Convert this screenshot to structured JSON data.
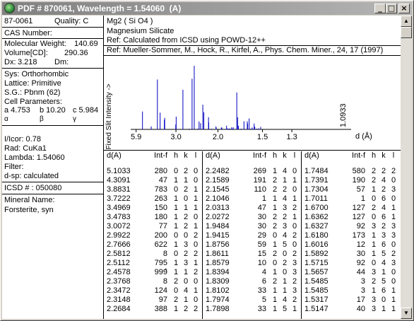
{
  "window": {
    "title": "PDF # 870061, Wavelength = 1.54060  (A)",
    "buttons": {
      "minimize": "_",
      "maximize": "□",
      "close": "×"
    }
  },
  "left": {
    "pdf_number": "87-0061",
    "quality": "Quality: C",
    "cas_label": "CAS Number:",
    "mol_weight_label": "Molecular Weight:",
    "mol_weight_value": "140.69",
    "volume_label": "Volume[CD]:",
    "volume_value": "290.36",
    "dx_label": "Dx:",
    "dx_value": "3.218",
    "dm_label": "Dm:",
    "sys": "Sys: Orthorhombic",
    "lattice": "Lattice: Primitive",
    "sg": "S.G.: Pbnm (62)",
    "cell_label": "Cell Parameters:",
    "cell_a": "a  4.753",
    "cell_b": "b  10.20",
    "cell_c": "c  5.984",
    "alpha": "α",
    "beta": "β",
    "gamma": "γ",
    "icor": "I/Icor:   0.78",
    "rad": "Rad: CuKa1",
    "lambda": "Lambda: 1.54060",
    "filter": "Filter:",
    "dsp": "d-sp: calculated",
    "icsd": "ICSD # : 050080",
    "mineral_label": "Mineral Name:",
    "mineral_value": "Forsterite, syn"
  },
  "right": {
    "formula": "Mg2 ( Si O4 )",
    "name": "Magnesium Silicate",
    "ref1": "Ref:  Calculated from ICSD using POWD-12++",
    "ref2": "Ref:  Mueller-Sommer, M., Hock, R., Kirfel, A., Phys. Chem. Miner., 24, 17 (1997)"
  },
  "chart_data": {
    "type": "bar",
    "ylabel": "Fixed Slit Intensity ->",
    "xlabel": "d (Å)",
    "xticks": [
      "5.9",
      "3.0",
      "2.0",
      "1.5",
      "1.3"
    ],
    "annotation": "1.0933",
    "peaks": [
      {
        "d": 5.1033,
        "i": 280
      },
      {
        "d": 4.3091,
        "i": 47
      },
      {
        "d": 3.8831,
        "i": 783
      },
      {
        "d": 3.7222,
        "i": 263
      },
      {
        "d": 3.4969,
        "i": 150
      },
      {
        "d": 3.4783,
        "i": 180
      },
      {
        "d": 3.0072,
        "i": 77
      },
      {
        "d": 2.9922,
        "i": 200
      },
      {
        "d": 2.7666,
        "i": 622
      },
      {
        "d": 2.5812,
        "i": 8
      },
      {
        "d": 2.5112,
        "i": 795
      },
      {
        "d": 2.4578,
        "i": 999
      },
      {
        "d": 2.3768,
        "i": 8
      },
      {
        "d": 2.3472,
        "i": 124
      },
      {
        "d": 2.3148,
        "i": 97
      },
      {
        "d": 2.2684,
        "i": 388
      },
      {
        "d": 2.2482,
        "i": 269
      },
      {
        "d": 2.1589,
        "i": 191
      },
      {
        "d": 2.1545,
        "i": 110
      },
      {
        "d": 2.1046,
        "i": 1
      },
      {
        "d": 2.0313,
        "i": 47
      },
      {
        "d": 2.0272,
        "i": 30
      },
      {
        "d": 1.9484,
        "i": 30
      },
      {
        "d": 1.9415,
        "i": 29
      },
      {
        "d": 1.8756,
        "i": 59
      },
      {
        "d": 1.8611,
        "i": 15
      },
      {
        "d": 1.8579,
        "i": 10
      },
      {
        "d": 1.8394,
        "i": 4
      },
      {
        "d": 1.8309,
        "i": 6
      },
      {
        "d": 1.8102,
        "i": 33
      },
      {
        "d": 1.7974,
        "i": 5
      },
      {
        "d": 1.7898,
        "i": 33
      },
      {
        "d": 1.7484,
        "i": 580
      },
      {
        "d": 1.7391,
        "i": 190
      },
      {
        "d": 1.7304,
        "i": 57
      },
      {
        "d": 1.7011,
        "i": 1
      },
      {
        "d": 1.67,
        "i": 127
      },
      {
        "d": 1.6362,
        "i": 127
      },
      {
        "d": 1.6327,
        "i": 92
      },
      {
        "d": 1.618,
        "i": 173
      },
      {
        "d": 1.6016,
        "i": 12
      },
      {
        "d": 1.5892,
        "i": 30
      },
      {
        "d": 1.5715,
        "i": 92
      },
      {
        "d": 1.5657,
        "i": 44
      },
      {
        "d": 1.5485,
        "i": 3
      },
      {
        "d": 1.5317,
        "i": 17
      },
      {
        "d": 1.5147,
        "i": 40
      }
    ]
  },
  "table": {
    "headers": [
      "d(A)",
      "Int-f",
      "h",
      "k",
      "l"
    ],
    "columns": [
      [
        [
          "5.1033",
          "280",
          "0",
          "2",
          "0",
          ""
        ],
        [
          "4.3091",
          "47",
          "1",
          "1",
          "0",
          ""
        ],
        [
          "3.8831",
          "783",
          "0",
          "2",
          "1",
          ""
        ],
        [
          "3.7222",
          "263",
          "1",
          "0",
          "1",
          ""
        ],
        [
          "3.4969",
          "150",
          "1",
          "1",
          "1",
          ""
        ],
        [
          "3.4783",
          "180",
          "1",
          "2",
          "0",
          ""
        ],
        [
          "3.0072",
          "77",
          "1",
          "2",
          "1",
          ""
        ],
        [
          "2.9922",
          "200",
          "0",
          "0",
          "2",
          ""
        ],
        [
          "2.7666",
          "622",
          "1",
          "3",
          "0",
          ""
        ],
        [
          "2.5812",
          "8",
          "0",
          "2",
          "2",
          ""
        ],
        [
          "2.5112",
          "795",
          "1",
          "3",
          "1",
          ""
        ],
        [
          "2.4578",
          "999",
          "1",
          "1",
          "2",
          "*"
        ],
        [
          "2.3768",
          "8",
          "2",
          "0",
          "0",
          ""
        ],
        [
          "2.3472",
          "124",
          "0",
          "4",
          "1",
          ""
        ],
        [
          "2.3148",
          "97",
          "2",
          "1",
          "0",
          ""
        ],
        [
          "2.2684",
          "388",
          "1",
          "2",
          "2",
          ""
        ]
      ],
      [
        [
          "2.2482",
          "269",
          "1",
          "4",
          "0",
          ""
        ],
        [
          "2.1589",
          "191",
          "2",
          "1",
          "1",
          ""
        ],
        [
          "2.1545",
          "110",
          "2",
          "2",
          "0",
          ""
        ],
        [
          "2.1046",
          "1",
          "1",
          "4",
          "1",
          ""
        ],
        [
          "2.0313",
          "47",
          "1",
          "3",
          "2",
          ""
        ],
        [
          "2.0272",
          "30",
          "2",
          "2",
          "1",
          ""
        ],
        [
          "1.9484",
          "30",
          "2",
          "3",
          "0",
          ""
        ],
        [
          "1.9415",
          "29",
          "0",
          "4",
          "2",
          ""
        ],
        [
          "1.8756",
          "59",
          "1",
          "5",
          "0",
          ""
        ],
        [
          "1.8611",
          "15",
          "2",
          "0",
          "2",
          ""
        ],
        [
          "1.8579",
          "10",
          "0",
          "2",
          "3",
          ""
        ],
        [
          "1.8394",
          "4",
          "1",
          "0",
          "3",
          ""
        ],
        [
          "1.8309",
          "6",
          "2",
          "1",
          "2",
          ""
        ],
        [
          "1.8102",
          "33",
          "1",
          "1",
          "3",
          ""
        ],
        [
          "1.7974",
          "5",
          "1",
          "4",
          "2",
          ""
        ],
        [
          "1.7898",
          "33",
          "1",
          "5",
          "1",
          ""
        ]
      ],
      [
        [
          "1.7484",
          "580",
          "2",
          "2",
          "2",
          ""
        ],
        [
          "1.7391",
          "190",
          "2",
          "4",
          "0",
          ""
        ],
        [
          "1.7304",
          "57",
          "1",
          "2",
          "3",
          ""
        ],
        [
          "1.7011",
          "1",
          "0",
          "6",
          "0",
          ""
        ],
        [
          "1.6700",
          "127",
          "2",
          "4",
          "1",
          ""
        ],
        [
          "1.6362",
          "127",
          "0",
          "6",
          "1",
          ""
        ],
        [
          "1.6327",
          "92",
          "3",
          "2",
          "3",
          ""
        ],
        [
          "1.6180",
          "173",
          "1",
          "3",
          "3",
          ""
        ],
        [
          "1.6016",
          "12",
          "1",
          "6",
          "0",
          ""
        ],
        [
          "1.5892",
          "30",
          "1",
          "5",
          "2",
          ""
        ],
        [
          "1.5715",
          "92",
          "0",
          "4",
          "3",
          ""
        ],
        [
          "1.5657",
          "44",
          "3",
          "1",
          "0",
          ""
        ],
        [
          "1.5485",
          "3",
          "2",
          "5",
          "0",
          ""
        ],
        [
          "1.5485",
          "3",
          "1",
          "6",
          "1",
          ""
        ],
        [
          "1.5317",
          "17",
          "3",
          "0",
          "1",
          ""
        ],
        [
          "1.5147",
          "40",
          "3",
          "1",
          "1",
          ""
        ]
      ]
    ]
  }
}
